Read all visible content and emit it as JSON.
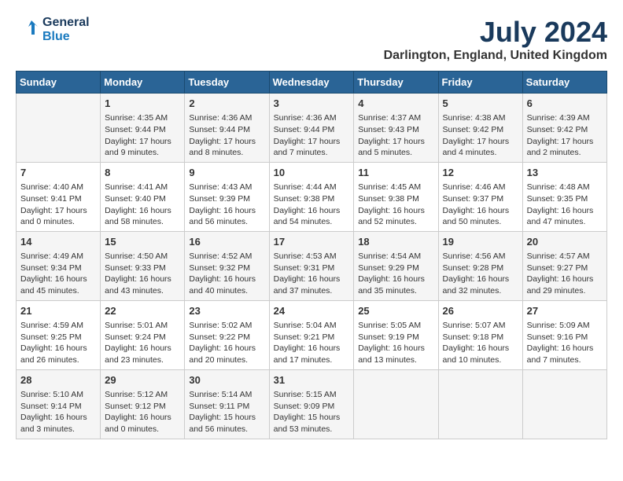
{
  "header": {
    "logo_line1": "General",
    "logo_line2": "Blue",
    "month_title": "July 2024",
    "location": "Darlington, England, United Kingdom"
  },
  "days_of_week": [
    "Sunday",
    "Monday",
    "Tuesday",
    "Wednesday",
    "Thursday",
    "Friday",
    "Saturday"
  ],
  "weeks": [
    [
      {
        "day": "",
        "content": ""
      },
      {
        "day": "1",
        "content": "Sunrise: 4:35 AM\nSunset: 9:44 PM\nDaylight: 17 hours\nand 9 minutes."
      },
      {
        "day": "2",
        "content": "Sunrise: 4:36 AM\nSunset: 9:44 PM\nDaylight: 17 hours\nand 8 minutes."
      },
      {
        "day": "3",
        "content": "Sunrise: 4:36 AM\nSunset: 9:44 PM\nDaylight: 17 hours\nand 7 minutes."
      },
      {
        "day": "4",
        "content": "Sunrise: 4:37 AM\nSunset: 9:43 PM\nDaylight: 17 hours\nand 5 minutes."
      },
      {
        "day": "5",
        "content": "Sunrise: 4:38 AM\nSunset: 9:42 PM\nDaylight: 17 hours\nand 4 minutes."
      },
      {
        "day": "6",
        "content": "Sunrise: 4:39 AM\nSunset: 9:42 PM\nDaylight: 17 hours\nand 2 minutes."
      }
    ],
    [
      {
        "day": "7",
        "content": "Sunrise: 4:40 AM\nSunset: 9:41 PM\nDaylight: 17 hours\nand 0 minutes."
      },
      {
        "day": "8",
        "content": "Sunrise: 4:41 AM\nSunset: 9:40 PM\nDaylight: 16 hours\nand 58 minutes."
      },
      {
        "day": "9",
        "content": "Sunrise: 4:43 AM\nSunset: 9:39 PM\nDaylight: 16 hours\nand 56 minutes."
      },
      {
        "day": "10",
        "content": "Sunrise: 4:44 AM\nSunset: 9:38 PM\nDaylight: 16 hours\nand 54 minutes."
      },
      {
        "day": "11",
        "content": "Sunrise: 4:45 AM\nSunset: 9:38 PM\nDaylight: 16 hours\nand 52 minutes."
      },
      {
        "day": "12",
        "content": "Sunrise: 4:46 AM\nSunset: 9:37 PM\nDaylight: 16 hours\nand 50 minutes."
      },
      {
        "day": "13",
        "content": "Sunrise: 4:48 AM\nSunset: 9:35 PM\nDaylight: 16 hours\nand 47 minutes."
      }
    ],
    [
      {
        "day": "14",
        "content": "Sunrise: 4:49 AM\nSunset: 9:34 PM\nDaylight: 16 hours\nand 45 minutes."
      },
      {
        "day": "15",
        "content": "Sunrise: 4:50 AM\nSunset: 9:33 PM\nDaylight: 16 hours\nand 43 minutes."
      },
      {
        "day": "16",
        "content": "Sunrise: 4:52 AM\nSunset: 9:32 PM\nDaylight: 16 hours\nand 40 minutes."
      },
      {
        "day": "17",
        "content": "Sunrise: 4:53 AM\nSunset: 9:31 PM\nDaylight: 16 hours\nand 37 minutes."
      },
      {
        "day": "18",
        "content": "Sunrise: 4:54 AM\nSunset: 9:29 PM\nDaylight: 16 hours\nand 35 minutes."
      },
      {
        "day": "19",
        "content": "Sunrise: 4:56 AM\nSunset: 9:28 PM\nDaylight: 16 hours\nand 32 minutes."
      },
      {
        "day": "20",
        "content": "Sunrise: 4:57 AM\nSunset: 9:27 PM\nDaylight: 16 hours\nand 29 minutes."
      }
    ],
    [
      {
        "day": "21",
        "content": "Sunrise: 4:59 AM\nSunset: 9:25 PM\nDaylight: 16 hours\nand 26 minutes."
      },
      {
        "day": "22",
        "content": "Sunrise: 5:01 AM\nSunset: 9:24 PM\nDaylight: 16 hours\nand 23 minutes."
      },
      {
        "day": "23",
        "content": "Sunrise: 5:02 AM\nSunset: 9:22 PM\nDaylight: 16 hours\nand 20 minutes."
      },
      {
        "day": "24",
        "content": "Sunrise: 5:04 AM\nSunset: 9:21 PM\nDaylight: 16 hours\nand 17 minutes."
      },
      {
        "day": "25",
        "content": "Sunrise: 5:05 AM\nSunset: 9:19 PM\nDaylight: 16 hours\nand 13 minutes."
      },
      {
        "day": "26",
        "content": "Sunrise: 5:07 AM\nSunset: 9:18 PM\nDaylight: 16 hours\nand 10 minutes."
      },
      {
        "day": "27",
        "content": "Sunrise: 5:09 AM\nSunset: 9:16 PM\nDaylight: 16 hours\nand 7 minutes."
      }
    ],
    [
      {
        "day": "28",
        "content": "Sunrise: 5:10 AM\nSunset: 9:14 PM\nDaylight: 16 hours\nand 3 minutes."
      },
      {
        "day": "29",
        "content": "Sunrise: 5:12 AM\nSunset: 9:12 PM\nDaylight: 16 hours\nand 0 minutes."
      },
      {
        "day": "30",
        "content": "Sunrise: 5:14 AM\nSunset: 9:11 PM\nDaylight: 15 hours\nand 56 minutes."
      },
      {
        "day": "31",
        "content": "Sunrise: 5:15 AM\nSunset: 9:09 PM\nDaylight: 15 hours\nand 53 minutes."
      },
      {
        "day": "",
        "content": ""
      },
      {
        "day": "",
        "content": ""
      },
      {
        "day": "",
        "content": ""
      }
    ]
  ]
}
